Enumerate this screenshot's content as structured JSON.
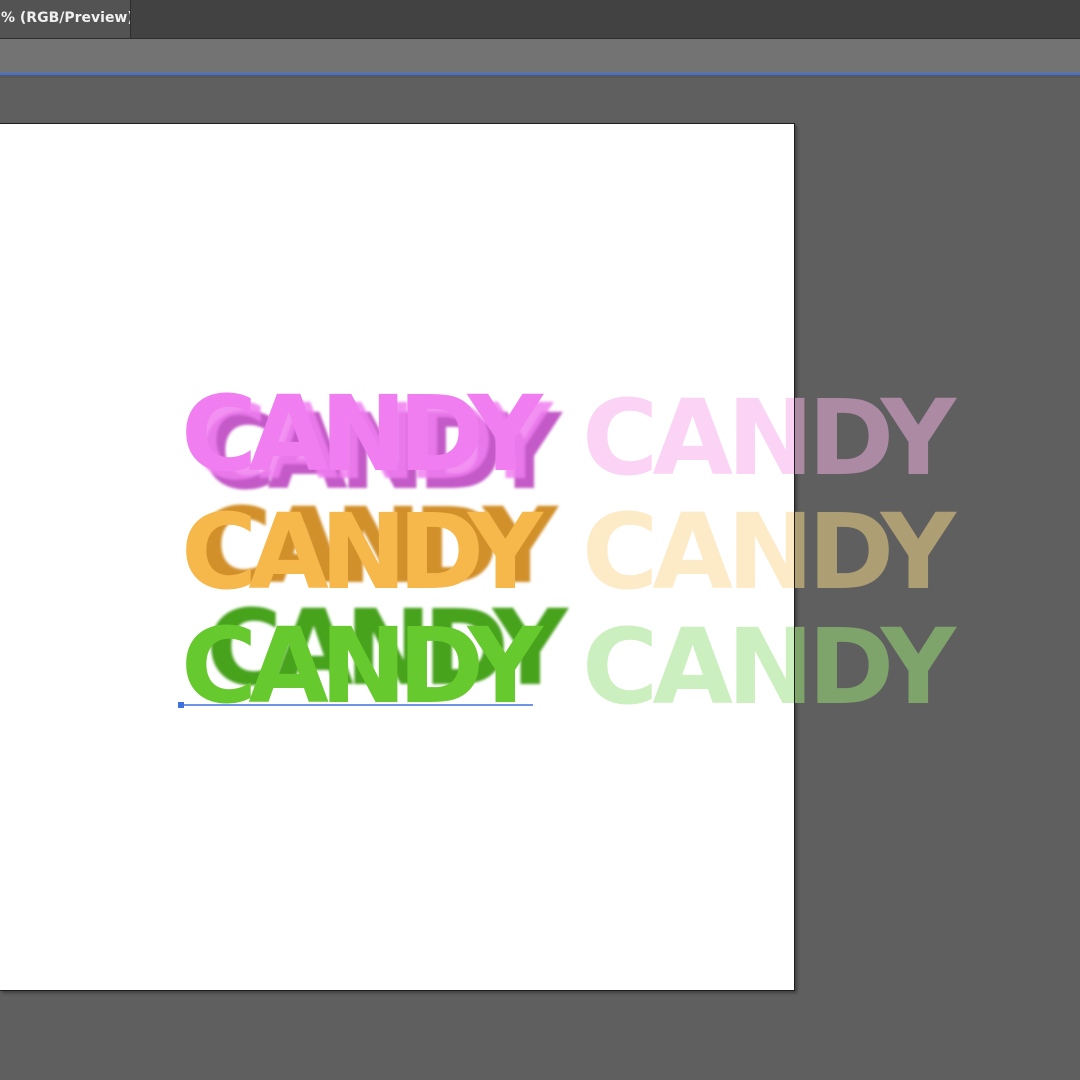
{
  "window": {
    "tab_title": "% (RGB/Preview)"
  },
  "artwork": {
    "word": "CANDY",
    "rows": [
      {
        "color": "#f07ef0",
        "dark_color": "#c45ac8",
        "faded_color": "#fbd3f5",
        "overflow_color": "#ad8aa3"
      },
      {
        "color": "#f6b84a",
        "dark_color": "#d2902c",
        "faded_color": "#fdeac6",
        "overflow_color": "#ae9e73"
      },
      {
        "color": "#66c92e",
        "dark_color": "#46a21c",
        "faded_color": "#ccefbf",
        "overflow_color": "#7ea46c"
      }
    ],
    "selection_color": "#3f72e0"
  }
}
